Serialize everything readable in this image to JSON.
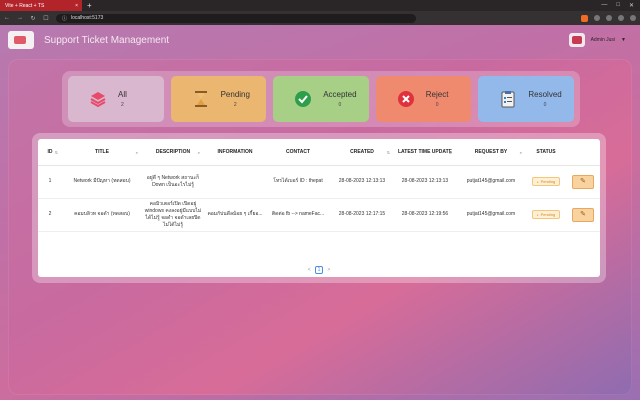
{
  "browser": {
    "tab_title": "Vite + React + TS",
    "tab_close": "×",
    "new_tab": "+",
    "url": "localhost:5173"
  },
  "app": {
    "title": "Support Ticket Management",
    "user_name": "Admin Jusi"
  },
  "cards": [
    {
      "label": "All",
      "count": "2",
      "icon": "stack-icon"
    },
    {
      "label": "Pending",
      "count": "2",
      "icon": "hourglass-icon"
    },
    {
      "label": "Accepted",
      "count": "0",
      "icon": "check-icon"
    },
    {
      "label": "Reject",
      "count": "0",
      "icon": "x-icon"
    },
    {
      "label": "Resolved",
      "count": "0",
      "icon": "clipboard-icon"
    }
  ],
  "table": {
    "headers": [
      "ID",
      "TITLE",
      "DESCRIPTION",
      "INFORMATION",
      "CONTACT",
      "CREATED",
      "LATEST TIME UPDATE",
      "REQUEST BY",
      "STATUS",
      ""
    ],
    "rows": [
      {
        "id": "1",
        "title": "Network มีปัญหา (ทดสอบ)",
        "description": "อยู่ดี ๆ Network สถานะก็ Down เป็นอะไรไม่รู้",
        "information": "",
        "contact": "โทรได้เบอร์ ID : thepat",
        "created": "28-08-2023 12:13:13",
        "updated": "28-08-2023 12:13:13",
        "request_by": "putjat145@gmail.com",
        "status": "Pending"
      },
      {
        "id": "2",
        "title": "คอมบลิวท จอดำ (ทดสอบ)",
        "description": "คอมิวเตอร์เปิด เปิดอยู่ windows คงลงอยู่มีแบบไม่ได้ไม่รู้ จอดำ จอดำเลยปิดไม่ได้ไม่รู้",
        "information": "คอมกับ่นดีลม้อย ๆ เกี้ยอ...",
        "contact": "ติดต่อ fb --> nameFac...",
        "created": "28-08-2023 12:17:15",
        "updated": "28-08-2023 12:19:56",
        "request_by": "putjat145@gmail.com",
        "status": "Pending"
      }
    ]
  },
  "pager": {
    "prev": "<",
    "current": "1",
    "next": ">"
  }
}
